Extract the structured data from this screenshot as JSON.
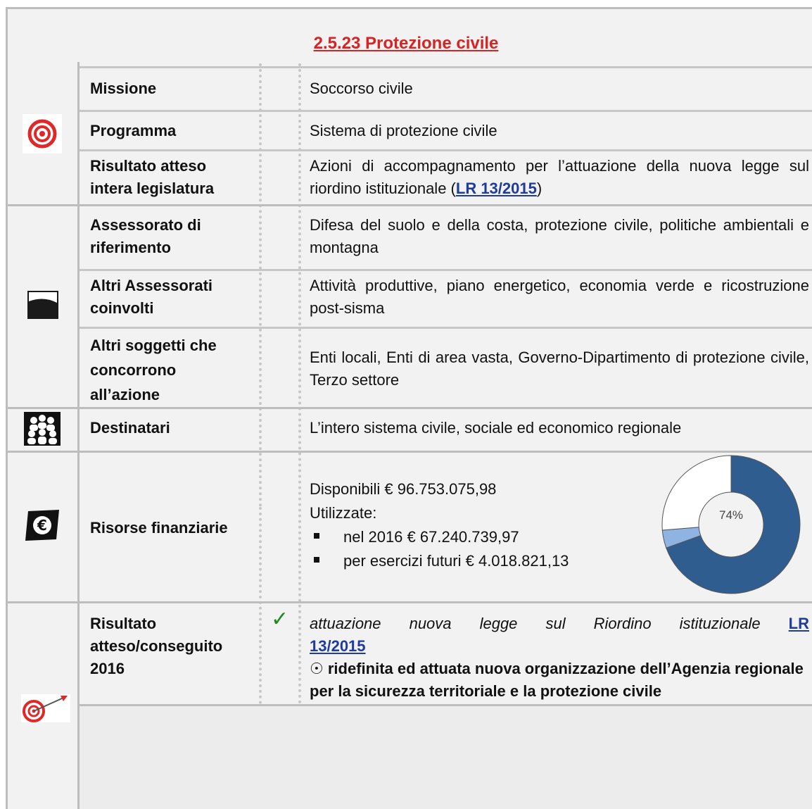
{
  "title": "2.5.23 Protezione civile",
  "rows": {
    "missione": {
      "label": "Missione",
      "value": "Soccorso civile"
    },
    "programma": {
      "label": "Programma",
      "value": "Sistema di protezione civile"
    },
    "risultato_atteso": {
      "label": [
        "Risultato atteso",
        "intera legislatura"
      ],
      "value_text": "Azioni di accompagnamento per l’attuazione della nuova legge sul riordino istituzionale (",
      "value_link": "LR 13/2015",
      "value_suffix": ")"
    },
    "assessorato": {
      "label": [
        "Assessorato di",
        "riferimento"
      ],
      "value": "Difesa del suolo e della costa, protezione civile, politiche ambientali e montagna"
    },
    "altri_assessorati": {
      "label": [
        "Altri Assessorati",
        "coinvolti"
      ],
      "value": "Attività produttive, piano energetico, economia verde e ricostruzione post-sisma"
    },
    "altri_soggetti": {
      "label": [
        "Altri soggetti che",
        "concorrono",
        "all’azione"
      ],
      "value": "Enti locali, Enti di area vasta, Governo-Dipartimento di protezione civile, Terzo settore"
    },
    "destinatari": {
      "label": "Destinatari",
      "value": "L’intero sistema civile, sociale ed economico regionale"
    },
    "risorse": {
      "label": "Risorse finanziarie",
      "disponibili": "Disponibili € 96.753.075,98",
      "utilizzate": "Utilizzate:",
      "items": [
        "nel 2016 € 67.240.739,97",
        "per esercizi futuri € 4.018.821,13"
      ]
    },
    "risultato_2016": {
      "label": [
        "Risultato",
        "atteso/conseguito",
        "2016"
      ],
      "check": "✓",
      "italic_text": "attuazione nuova legge sul Riordino istituzionale",
      "link": "LR 13/2015",
      "bullet_symbol": "☉",
      "bold_text": "ridefinita ed attuata nuova organizzazione dell’Agenzia regionale per la sicurezza territoriale e la protezione civile"
    }
  },
  "chart_data": {
    "type": "pie",
    "donut": true,
    "center_label": "74%",
    "slices": [
      {
        "value": 69.5,
        "color": "#2f5d8f"
      },
      {
        "value": 4.2,
        "color": "#8fb4e3"
      },
      {
        "value": 26.3,
        "color": "#ffffff"
      }
    ]
  },
  "icons": [
    "target-icon",
    "region-flag-icon",
    "people-icon",
    "euro-icon",
    "dart-target-icon"
  ]
}
